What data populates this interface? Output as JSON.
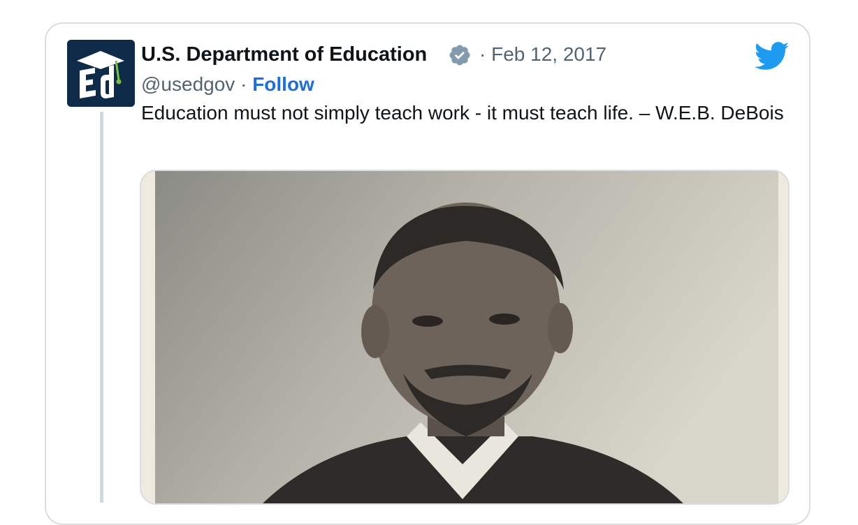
{
  "tweet": {
    "author_name": "U.S. Department of Education",
    "separator": "·",
    "date": "Feb 12, 2017",
    "handle": "@usedgov",
    "follow_label": "Follow",
    "text": "Education must not simply teach work - it must teach life. – W.E.B. DeBois",
    "avatar_letters": "Ed",
    "media_alt": "Portrait photograph of W.E.B. Du Bois"
  },
  "colors": {
    "name": "#0f1419",
    "secondary": "#536471",
    "follow": "#1d6fd4",
    "twitter_blue": "#1d9bf0",
    "avatar_bg": "#0f2b4a",
    "avatar_accent": "#7cc242",
    "border": "#d9dee2"
  },
  "icons": [
    "verified-badge-icon",
    "twitter-bird-icon",
    "ed-logo-icon"
  ]
}
